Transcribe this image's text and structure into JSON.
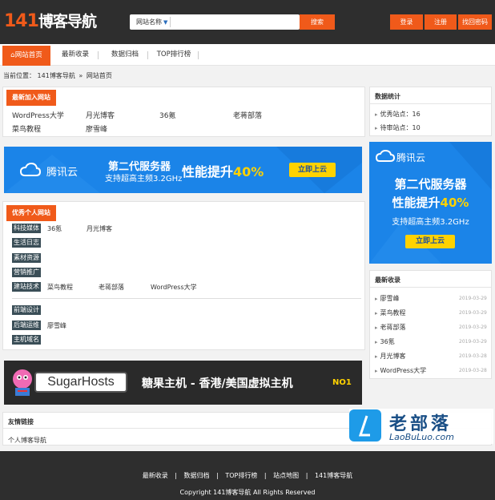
{
  "header": {
    "logo_number": "141",
    "logo_text": "博客导航",
    "search_select": "网站名称",
    "search_button": "搜索",
    "buttons": [
      "登录",
      "注册",
      "找回密码"
    ]
  },
  "nav": {
    "items": [
      "网站首页",
      "最新收录",
      "数据归档",
      "TOP排行榜"
    ]
  },
  "breadcrumb": {
    "prefix": "当前位置：",
    "site": "141博客导航",
    "sep": "»",
    "current": "网站首页"
  },
  "newest": {
    "title": "最新加入网站",
    "links": [
      "WordPress大学",
      "月光博客",
      "36氪",
      "老蒋部落",
      "菜鸟教程",
      "廖雪峰"
    ]
  },
  "tencent_banner": {
    "brand": "腾讯云",
    "line1": "第二代服务器",
    "line2": "支持超高主频3.2GHz",
    "perf_text": "性能提升",
    "perf_value": "40%",
    "cta": "立即上云"
  },
  "categories": {
    "title": "优秀个人网站",
    "rows": [
      {
        "badge": "科技媒体",
        "links": [
          "36氪",
          "月光博客"
        ]
      },
      {
        "badge": "生活日志",
        "links": []
      },
      {
        "badge": "素材资源",
        "links": []
      },
      {
        "badge": "营销推广",
        "links": []
      },
      {
        "badge": "建站技术",
        "links": [
          "菜鸟教程",
          "老蒋部落",
          "WordPress大学"
        ]
      },
      {
        "badge": "前端设计",
        "links": []
      },
      {
        "badge": "后端运维",
        "links": [
          "廖雪峰"
        ]
      },
      {
        "badge": "主机域名",
        "links": []
      }
    ]
  },
  "sugar_banner": {
    "brand": "SugarHosts",
    "slogan": "糖果主机 - 香港/美国虚拟主机",
    "tag": "NO1"
  },
  "friend_links": {
    "title": "友情链接",
    "links": [
      "个人博客导航"
    ]
  },
  "stats": {
    "title": "数据统计",
    "items": [
      "优秀站点：16",
      "待审站点：10"
    ]
  },
  "side_banner": {
    "brand": "腾讯云",
    "line1": "第二代服务器",
    "perf_text": "性能提升",
    "perf_value": "40%",
    "line3": "支持超高主频3.2GHz",
    "cta": "立即上云"
  },
  "latest": {
    "title": "最新收录",
    "items": [
      {
        "name": "廖雪峰",
        "date": "2019-03-29"
      },
      {
        "name": "菜鸟教程",
        "date": "2019-03-29"
      },
      {
        "name": "老蒋部落",
        "date": "2019-03-29"
      },
      {
        "name": "36氪",
        "date": "2019-03-29"
      },
      {
        "name": "月光博客",
        "date": "2019-03-28"
      },
      {
        "name": "WordPress大学",
        "date": "2019-03-28"
      }
    ]
  },
  "watermark": {
    "cn": "老部落",
    "en": "LaoBuLuo.com"
  },
  "footer": {
    "links": [
      "最新收录",
      "数据归档",
      "TOP排行榜",
      "站点地图",
      "141博客导航"
    ],
    "sep": "|",
    "copyright": "Copyright 141博客导航 All Rights Reserved"
  },
  "colors": {
    "accent": "#f05a1a",
    "header_bg": "#2e2e2e",
    "tencent_blue": "#1b84e8",
    "badge_bg": "#3a4e57"
  }
}
